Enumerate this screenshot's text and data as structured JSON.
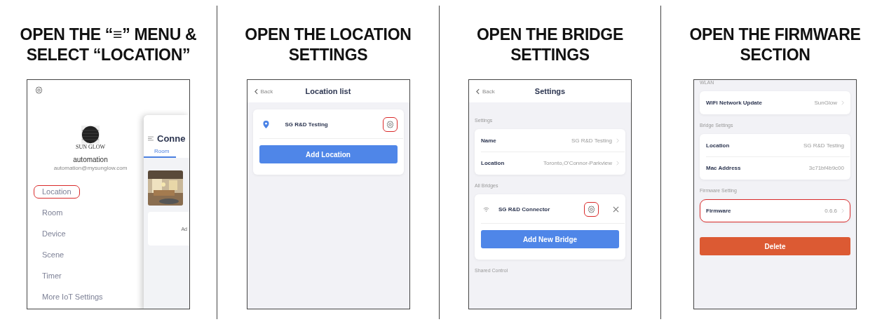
{
  "steps": [
    {
      "title_lines": [
        "OPEN THE “≡” MENU &",
        "SELECT “LOCATION”"
      ],
      "screen": {
        "kind": "drawer",
        "logo_text": "SUN GLOW",
        "user_name": "automation",
        "user_email": "automation@mysunglow.com",
        "menu": [
          {
            "label": "Location",
            "highlighted": true
          },
          {
            "label": "Room",
            "highlighted": false
          },
          {
            "label": "Device",
            "highlighted": false
          },
          {
            "label": "Scene",
            "highlighted": false
          },
          {
            "label": "Timer",
            "highlighted": false
          },
          {
            "label": "More IoT Settings",
            "highlighted": false
          }
        ],
        "behind": {
          "title": "Conne",
          "tabs": [
            {
              "label": "Room",
              "selected": true
            }
          ],
          "card_text": "Ad"
        }
      }
    },
    {
      "title_lines": [
        "OPEN THE LOCATION",
        "SETTINGS"
      ],
      "screen": {
        "kind": "page",
        "header": {
          "back": "Back",
          "title": "Location list"
        },
        "blocks": [
          {
            "kind": "card",
            "highlighted": false,
            "rows": [
              {
                "kind": "location",
                "name": "SG R&D Testing",
                "gear_highlighted": true
              },
              {
                "kind": "button",
                "label": "Add Location"
              }
            ]
          }
        ]
      }
    },
    {
      "title_lines": [
        "OPEN THE BRIDGE",
        "SETTINGS"
      ],
      "screen": {
        "kind": "page",
        "header": {
          "back": "Back",
          "title": "Settings"
        },
        "blocks": [
          {
            "kind": "caption",
            "text": "Settings"
          },
          {
            "kind": "card",
            "highlighted": false,
            "rows": [
              {
                "kind": "row",
                "label": "Name",
                "value": "SG R&D Testing",
                "chevron": true
              },
              {
                "kind": "row",
                "label": "Location",
                "value": "Toronto,O'Connor-Parkview",
                "chevron": true
              }
            ]
          },
          {
            "kind": "caption",
            "text": "All Bridges"
          },
          {
            "kind": "card",
            "highlighted": false,
            "rows": [
              {
                "kind": "bridge",
                "name": "SG R&D Connector",
                "gear_highlighted": true
              },
              {
                "kind": "button",
                "label": "Add New Bridge"
              }
            ]
          },
          {
            "kind": "caption",
            "text": "Shared Control"
          }
        ]
      }
    },
    {
      "title_lines": [
        "OPEN THE FIRMWARE",
        "SECTION"
      ],
      "screen": {
        "kind": "page",
        "blocks": [
          {
            "kind": "caption",
            "text": "WLAN"
          },
          {
            "kind": "card",
            "highlighted": false,
            "rows": [
              {
                "kind": "row",
                "label": "WiFi Network Update",
                "value": "SunGlow",
                "chevron": true
              }
            ]
          },
          {
            "kind": "caption",
            "text": "Bridge Settings"
          },
          {
            "kind": "card",
            "highlighted": false,
            "rows": [
              {
                "kind": "row",
                "label": "Location",
                "value": "SG R&D Testing",
                "chevron": false
              },
              {
                "kind": "row",
                "label": "Mac Address",
                "value": "3c71bf4b9c00",
                "chevron": false
              }
            ]
          },
          {
            "kind": "caption",
            "text": "Firmware Setting"
          },
          {
            "kind": "card",
            "highlighted": true,
            "rows": [
              {
                "kind": "row",
                "label": "Firmware",
                "value": "0.6.6",
                "chevron": true
              }
            ]
          },
          {
            "kind": "danger",
            "label": "Delete"
          }
        ]
      }
    }
  ]
}
